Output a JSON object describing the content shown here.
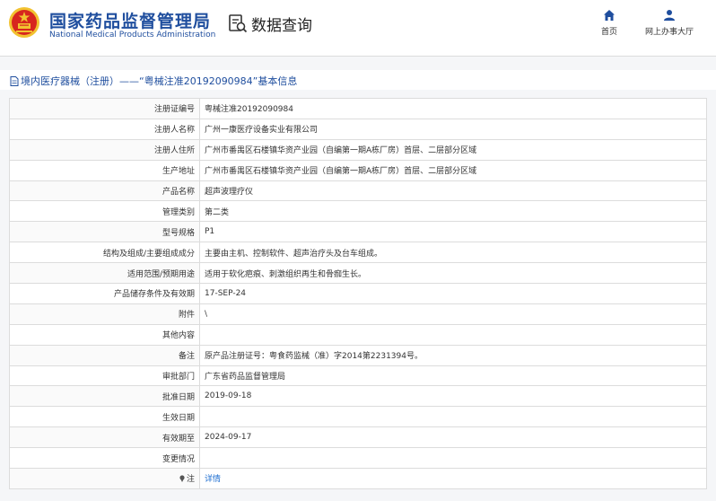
{
  "header": {
    "org_name_cn": "国家药品监督管理局",
    "org_name_en": "National Medical Products Administration",
    "query_title": "数据查询",
    "nav": [
      {
        "label": "首页",
        "icon": "home-icon"
      },
      {
        "label": "网上办事大厅",
        "icon": "user-icon"
      }
    ]
  },
  "breadcrumb": {
    "text": "境内医疗器械（注册）——“粤械注准20192090984”基本信息"
  },
  "detail": {
    "rows": [
      {
        "label": "注册证编号",
        "value": "粤械注准20192090984"
      },
      {
        "label": "注册人名称",
        "value": "广州一康医疗设备实业有限公司"
      },
      {
        "label": "注册人住所",
        "value": "广州市番禺区石楼镇华资产业园（自编第一期A栋厂房）首层、二层部分区域"
      },
      {
        "label": "生产地址",
        "value": "广州市番禺区石楼镇华资产业园（自编第一期A栋厂房）首层、二层部分区域"
      },
      {
        "label": "产品名称",
        "value": "超声波理疗仪"
      },
      {
        "label": "管理类别",
        "value": "第二类"
      },
      {
        "label": "型号规格",
        "value": "P1"
      },
      {
        "label": "结构及组成/主要组成成分",
        "value": "主要由主机、控制软件、超声治疗头及台车组成。"
      },
      {
        "label": "适用范围/预期用途",
        "value": "适用于软化疤痕、刺激组织再生和骨痂生长。"
      },
      {
        "label": "产品储存条件及有效期",
        "value": "17-SEP-24"
      },
      {
        "label": "附件",
        "value": "\\"
      },
      {
        "label": "其他内容",
        "value": ""
      },
      {
        "label": "备注",
        "value": "原产品注册证号：粤食药监械（准）字2014第2231394号。"
      },
      {
        "label": "审批部门",
        "value": "广东省药品监督管理局"
      },
      {
        "label": "批准日期",
        "value": "2019-09-18"
      },
      {
        "label": "生效日期",
        "value": ""
      },
      {
        "label": "有效期至",
        "value": "2024-09-17"
      },
      {
        "label": "变更情况",
        "value": ""
      }
    ],
    "note_label": "注",
    "note_link": "详情"
  },
  "colors": {
    "brand_blue": "#1f4e9e",
    "link_blue": "#1f6fd1",
    "emblem_red": "#d7261e",
    "emblem_gold": "#f2c230"
  }
}
